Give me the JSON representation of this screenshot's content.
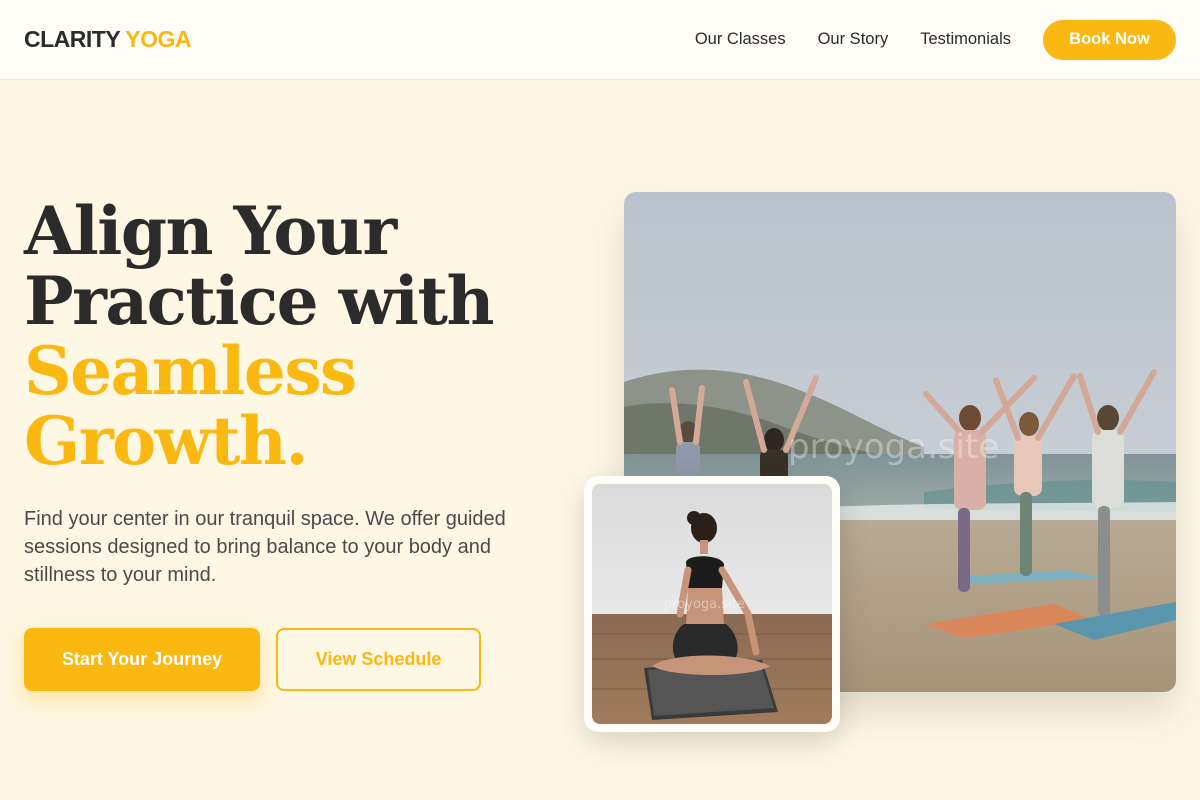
{
  "brand": {
    "part1": "CLARITY",
    "part2": "YOGA"
  },
  "nav": {
    "items": [
      "Our Classes",
      "Our Story",
      "Testimonials"
    ],
    "cta": "Book Now"
  },
  "hero": {
    "headline_line1": "Align Your",
    "headline_line2": "Practice with",
    "headline_accent1": "Seamless",
    "headline_accent2": "Growth.",
    "subtext": "Find your center in our tranquil space. We offer guided sessions designed to bring balance to your body and stillness to your mind.",
    "primary_button": "Start Your Journey",
    "secondary_button": "View Schedule"
  },
  "images": {
    "large_watermark": "proyoga.site",
    "small_watermark": "proyoga.site"
  },
  "colors": {
    "accent": "#fbb811",
    "background": "#fef7e3",
    "text": "#2b2b2b"
  }
}
